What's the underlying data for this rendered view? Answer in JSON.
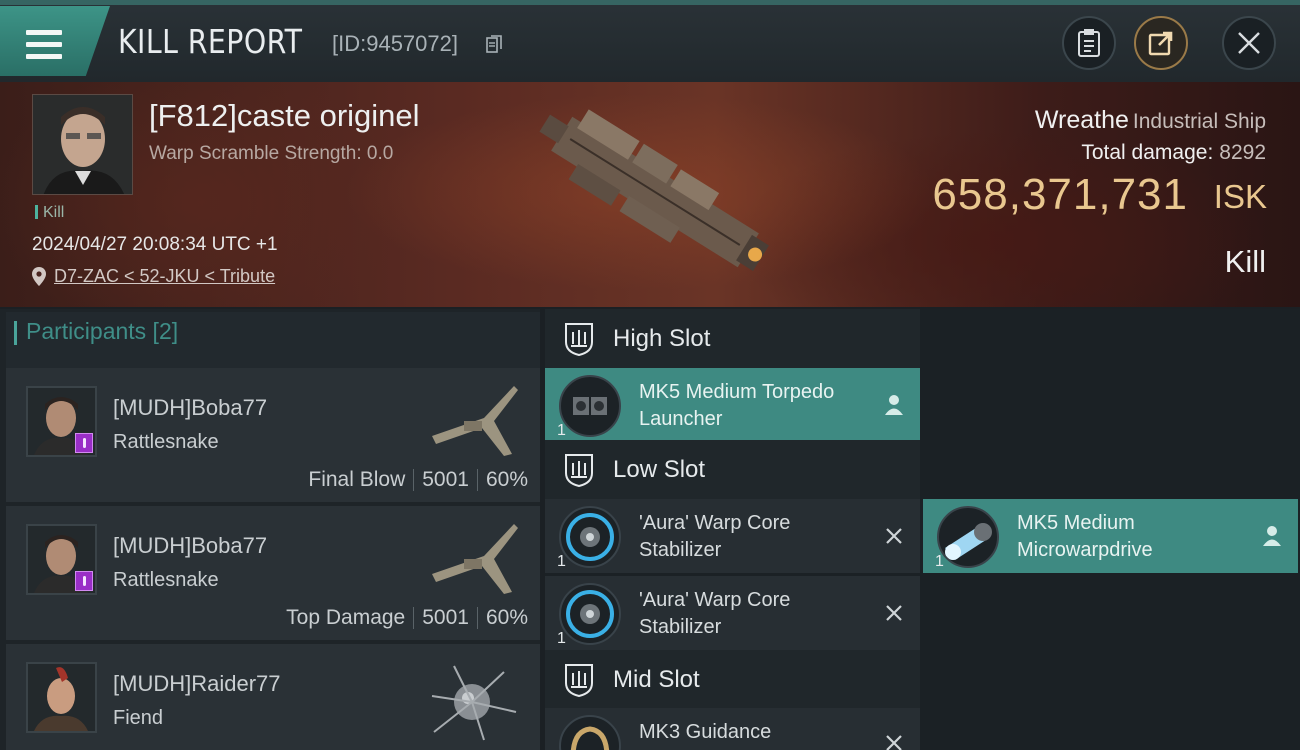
{
  "header": {
    "title": "KILL REPORT",
    "report_id": "[ID:9457072]",
    "icons": [
      "menu-icon",
      "copy-icon",
      "clipboard-icon",
      "share-icon",
      "close-icon"
    ]
  },
  "victim": {
    "name": "[F812]caste originel",
    "scramble": "Warp Scramble Strength: 0.0",
    "tag": "Kill",
    "time": "2024/04/27 20:08:34 UTC +1",
    "location": "D7-ZAC < 52-JKU < Tribute",
    "ship_name": "Wreathe",
    "ship_class": "Industrial Ship",
    "total_damage_label": "Total damage:",
    "total_damage": "8292",
    "isk_value": "658,371,731",
    "isk_unit": "ISK",
    "result": "Kill"
  },
  "participants": {
    "title": "Participants [2]",
    "rows": [
      {
        "name": "[MUDH]Boba77",
        "ship": "Rattlesnake",
        "role": "Final Blow",
        "damage": "5001",
        "percent": "60%"
      },
      {
        "name": "[MUDH]Boba77",
        "ship": "Rattlesnake",
        "role": "Top Damage",
        "damage": "5001",
        "percent": "60%"
      },
      {
        "name": "[MUDH]Raider77",
        "ship": "Fiend"
      }
    ]
  },
  "fitting": {
    "high_slot": "High Slot",
    "low_slot": "Low Slot",
    "mid_slot": "Mid Slot",
    "high_modules": [
      {
        "qty": "1",
        "name": "MK5 Medium Torpedo Launcher",
        "status": "dropped"
      }
    ],
    "low_modules": [
      {
        "qty": "1",
        "name": "'Aura' Warp Core Stabilizer",
        "status": "destroyed"
      },
      {
        "qty": "1",
        "name": "MK5 Medium Microwarpdrive",
        "status": "dropped"
      },
      {
        "qty": "1",
        "name": "'Aura' Warp Core Stabilizer",
        "status": "destroyed"
      }
    ],
    "mid_modules": [
      {
        "name": "MK3 Guidance"
      }
    ]
  },
  "colors": {
    "accent": "#3e8a82",
    "isk": "#e9c78f",
    "corp_badge": "#9a2ec7"
  }
}
